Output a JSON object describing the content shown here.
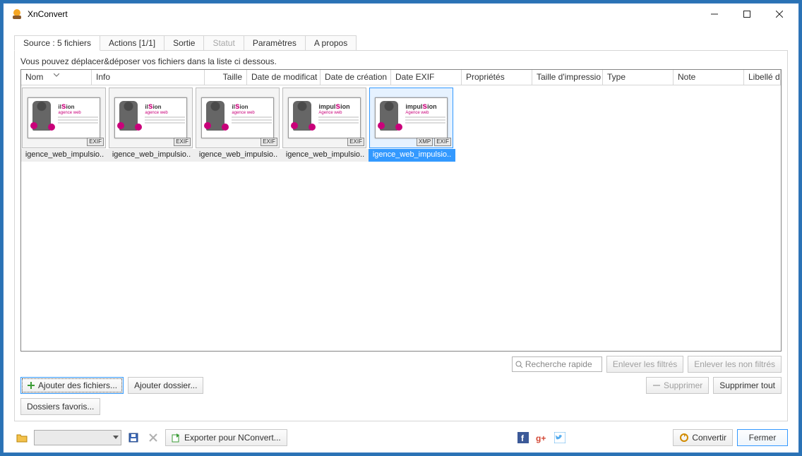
{
  "app": {
    "title": "XnConvert"
  },
  "tabs": {
    "source": "Source : 5 fichiers",
    "actions": "Actions [1/1]",
    "sortie": "Sortie",
    "statut": "Statut",
    "parametres": "Paramètres",
    "apropos": "A propos"
  },
  "hint": "Vous pouvez déplacer&déposer vos fichiers dans la liste ci dessous.",
  "columns": {
    "nom": "Nom",
    "info": "Info",
    "taille": "Taille",
    "datemod": "Date de modificat",
    "datecre": "Date de création",
    "dateexif": "Date EXIF",
    "proprietes": "Propriétés",
    "tailleimp": "Taille d'impressio",
    "type": "Type",
    "note": "Note",
    "libelle": "Libellé de cou"
  },
  "files": [
    {
      "name": "igence_web_impulsio..",
      "badges": [
        "EXIF"
      ],
      "brand": "ilsion",
      "sub": "agence web",
      "style": "small",
      "selected": false
    },
    {
      "name": "igence_web_impulsio..",
      "badges": [
        "EXIF"
      ],
      "brand": "ilsion",
      "sub": "agence web",
      "style": "small",
      "selected": false
    },
    {
      "name": "igence_web_impulsio..",
      "badges": [
        "EXIF"
      ],
      "brand": "ilsion",
      "sub": "agence web",
      "style": "small",
      "selected": false
    },
    {
      "name": "igence_web_impulsio..",
      "badges": [
        "EXIF"
      ],
      "brand": "impulsion",
      "sub": "Agence web",
      "style": "big",
      "selected": false
    },
    {
      "name": "igence_web_impulsio..",
      "badges": [
        "XMP",
        "EXIF"
      ],
      "brand": "impulsion",
      "sub": "Agence web",
      "style": "big",
      "selected": true
    }
  ],
  "search_placeholder": "Recherche rapide",
  "buttons": {
    "enlever_filtres": "Enlever les filtrés",
    "enlever_non_filtres": "Enlever les non filtrés",
    "ajouter_fichiers": "Ajouter des fichiers...",
    "ajouter_dossier": "Ajouter dossier...",
    "supprimer": "Supprimer",
    "supprimer_tout": "Supprimer tout",
    "dossiers_favoris": "Dossiers favoris...",
    "exporter": "Exporter pour NConvert...",
    "convertir": "Convertir",
    "fermer": "Fermer"
  }
}
